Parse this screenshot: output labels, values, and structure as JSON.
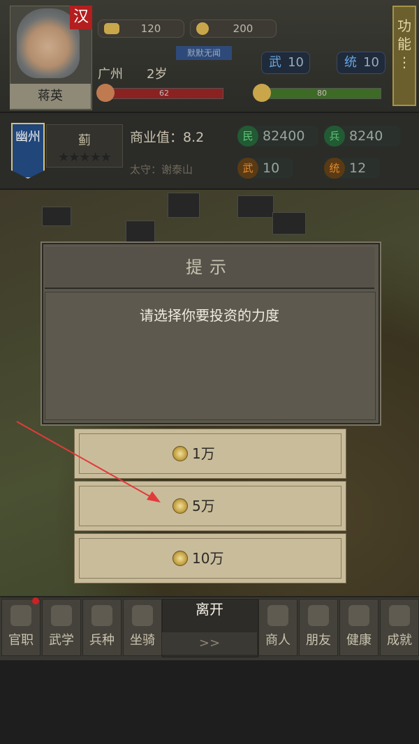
{
  "player": {
    "nation": "汉",
    "name": "蒋英",
    "gold": "120",
    "coins": "200",
    "tag": "默默无闻",
    "place": "广州",
    "age": "2岁",
    "wu_label": "武",
    "wu_value": "10",
    "tong_label": "统",
    "tong_value": "10",
    "hp": "62",
    "hp_fraction": 1.0,
    "sp": "80",
    "sp_fraction": 1.0
  },
  "function_button": "功能⋮",
  "city": {
    "province": "幽州",
    "name": "蓟",
    "stars": "★★★★★",
    "commerce": "商业值：8.2",
    "governor": "太守：谢泰山",
    "min_label": "民",
    "min_value": "82400",
    "bing_label": "兵",
    "bing_value": "8240",
    "wu_label": "武",
    "wu_value": "10",
    "tong_label": "统",
    "tong_value": "12"
  },
  "dialog": {
    "title": "提示",
    "message": "请选择你要投资的力度",
    "options": [
      {
        "label": "1万"
      },
      {
        "label": "5万"
      },
      {
        "label": "10万"
      }
    ]
  },
  "nav": {
    "left": [
      "官职",
      "武学",
      "兵种",
      "坐骑"
    ],
    "right": [
      "商人",
      "朋友",
      "健康",
      "成就"
    ],
    "leave": "离开",
    "arrows": ">>"
  },
  "colors": {
    "annotation_arrow": "#e23b3b",
    "option_bg": "#c9bc9b",
    "nation_red": "#b41e1e"
  },
  "icons": [
    "gold-ingot-icon",
    "coin-icon",
    "heart-icon",
    "lightning-icon",
    "coin-icon"
  ]
}
